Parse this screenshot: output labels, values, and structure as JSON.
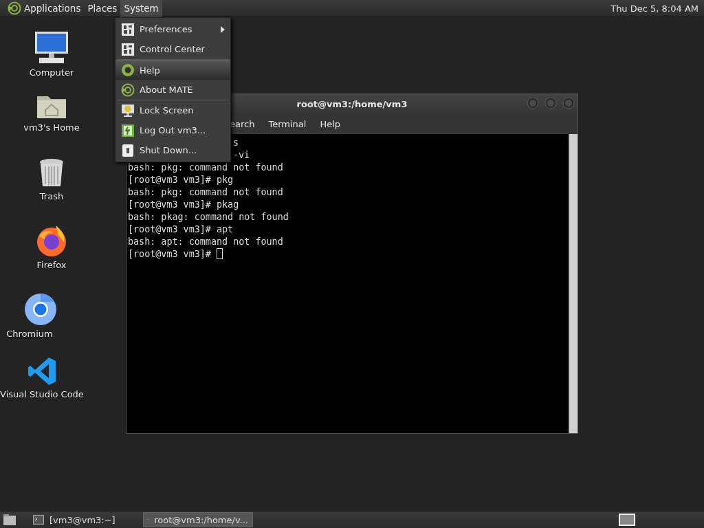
{
  "top_panel": {
    "menus": [
      {
        "label": "Applications",
        "selected": false
      },
      {
        "label": "Places",
        "selected": false
      },
      {
        "label": "System",
        "selected": true
      }
    ],
    "clock": "Thu Dec 5, 8:04 AM"
  },
  "desktop_icons": [
    {
      "label": "Computer",
      "kind": "computer"
    },
    {
      "label": "vm3's Home",
      "kind": "home"
    },
    {
      "label": "Trash",
      "kind": "trash"
    },
    {
      "label": "Firefox",
      "kind": "firefox"
    },
    {
      "label": "Chromium",
      "kind": "chromium"
    },
    {
      "label": "Visual Studio Code",
      "kind": "vscode"
    }
  ],
  "system_menu": {
    "items": [
      {
        "kind": "item",
        "label": "Preferences",
        "submenu": true,
        "selected": false
      },
      {
        "kind": "item",
        "label": "Control Center",
        "submenu": false,
        "selected": false
      },
      {
        "kind": "separator"
      },
      {
        "kind": "item",
        "label": "Help",
        "submenu": false,
        "selected": true
      },
      {
        "kind": "item",
        "label": "About MATE",
        "submenu": false,
        "selected": false
      },
      {
        "kind": "separator"
      },
      {
        "kind": "item",
        "label": "Lock Screen",
        "submenu": false,
        "selected": false
      },
      {
        "kind": "item",
        "label": "Log Out vm3...",
        "submenu": false,
        "selected": false
      },
      {
        "kind": "item",
        "label": "Shut Down...",
        "submenu": false,
        "selected": false
      }
    ]
  },
  "terminal_window": {
    "title": "root@vm3:/home/vm3",
    "menu": [
      "earch",
      "Terminal",
      "Help"
    ],
    "lines": [
      {
        "text": "s",
        "kind": "cut"
      },
      {
        "text": "-vi",
        "kind": "cut"
      },
      {
        "text": "bash: pkg: command not found",
        "kind": "full"
      },
      {
        "text": "[root@vm3 vm3]# pkg",
        "kind": "full"
      },
      {
        "text": "bash: pkg: command not found",
        "kind": "full"
      },
      {
        "text": "[root@vm3 vm3]# pkag",
        "kind": "full"
      },
      {
        "text": "bash: pkag: command not found",
        "kind": "full"
      },
      {
        "text": "[root@vm3 vm3]# apt",
        "kind": "full"
      },
      {
        "text": "bash: apt: command not found",
        "kind": "full"
      },
      {
        "text": "[root@vm3 vm3]# ",
        "kind": "prompt"
      }
    ]
  },
  "taskbar": {
    "tasks": [
      {
        "label": "[vm3@vm3:~]",
        "selected": false
      },
      {
        "label": "root@vm3:/home/v...",
        "selected": true
      }
    ]
  }
}
